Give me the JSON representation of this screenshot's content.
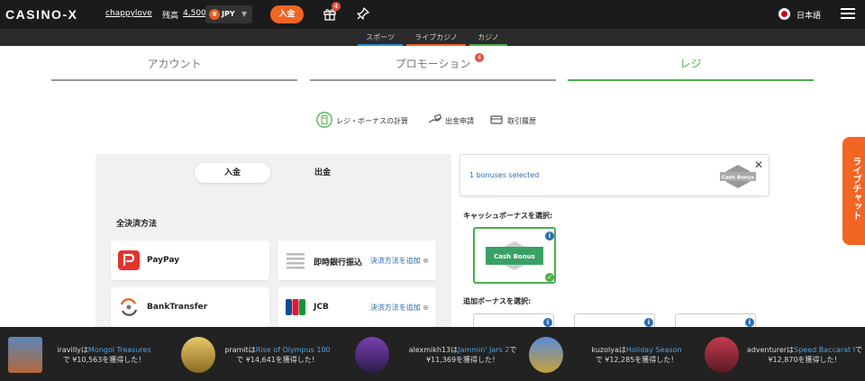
{
  "header": {
    "logo": "CASINO-X",
    "username": "chappylove",
    "balance_label": "残高",
    "balance_value": "4,500",
    "currency_symbol": "¥",
    "currency_code": "JPY",
    "deposit_label": "入金",
    "gift_badge": "4",
    "language": "日本語"
  },
  "subnav": [
    {
      "label": "スポーツ",
      "color": "#2b8fd6"
    },
    {
      "label": "ライブカジノ",
      "color": "#f26522"
    },
    {
      "label": "カジノ",
      "color": "#4caf50"
    }
  ],
  "tabs": [
    {
      "label": "アカウント"
    },
    {
      "label": "プロモーション",
      "badge": "4"
    },
    {
      "label": "レジ"
    }
  ],
  "sub_actions": [
    {
      "label": "レジ・ボーナスの計算"
    },
    {
      "label": "出金申請"
    },
    {
      "label": "取引履歴"
    }
  ],
  "payment": {
    "toggle": [
      "入金",
      "出金"
    ],
    "section_title": "全決済方法",
    "methods": [
      {
        "name": "PayPay",
        "add": ""
      },
      {
        "name": "即時銀行振込",
        "add": "決済方法を追加"
      },
      {
        "name": "BankTransfer",
        "add": ""
      },
      {
        "name": "JCB",
        "add": "決済方法を追加"
      }
    ]
  },
  "bonus": {
    "selected_text": "1 bonuses selected",
    "hex_label": "Cash Bonus",
    "cash_label": "キャッシュボーナスを選択:",
    "cash_card_label": "Cash Bonus",
    "extra_label": "追加ボーナスを選択:"
  },
  "livechat": "ライブチャット",
  "winners": [
    {
      "user": "iravilly",
      "wa": "は",
      "game": "Mongol Treasures",
      "amount": "で ¥10,563を獲得した！"
    },
    {
      "user": "pramit",
      "wa": "は",
      "game": "Rise of Olympus 100",
      "amount": "で ¥14,641を獲得した！"
    },
    {
      "user": "alexmikh13",
      "wa": "は",
      "game": "Jammin' Jars 2",
      "amount": "で ¥11,369を獲得した！"
    },
    {
      "user": "kuzolya",
      "wa": "は",
      "game": "Holiday Season",
      "amount": "で ¥12,285を獲得した！"
    },
    {
      "user": "adventurer",
      "wa": "は",
      "game": "Speed Baccarat I",
      "amount": "で ¥12,870を獲得した！"
    }
  ]
}
